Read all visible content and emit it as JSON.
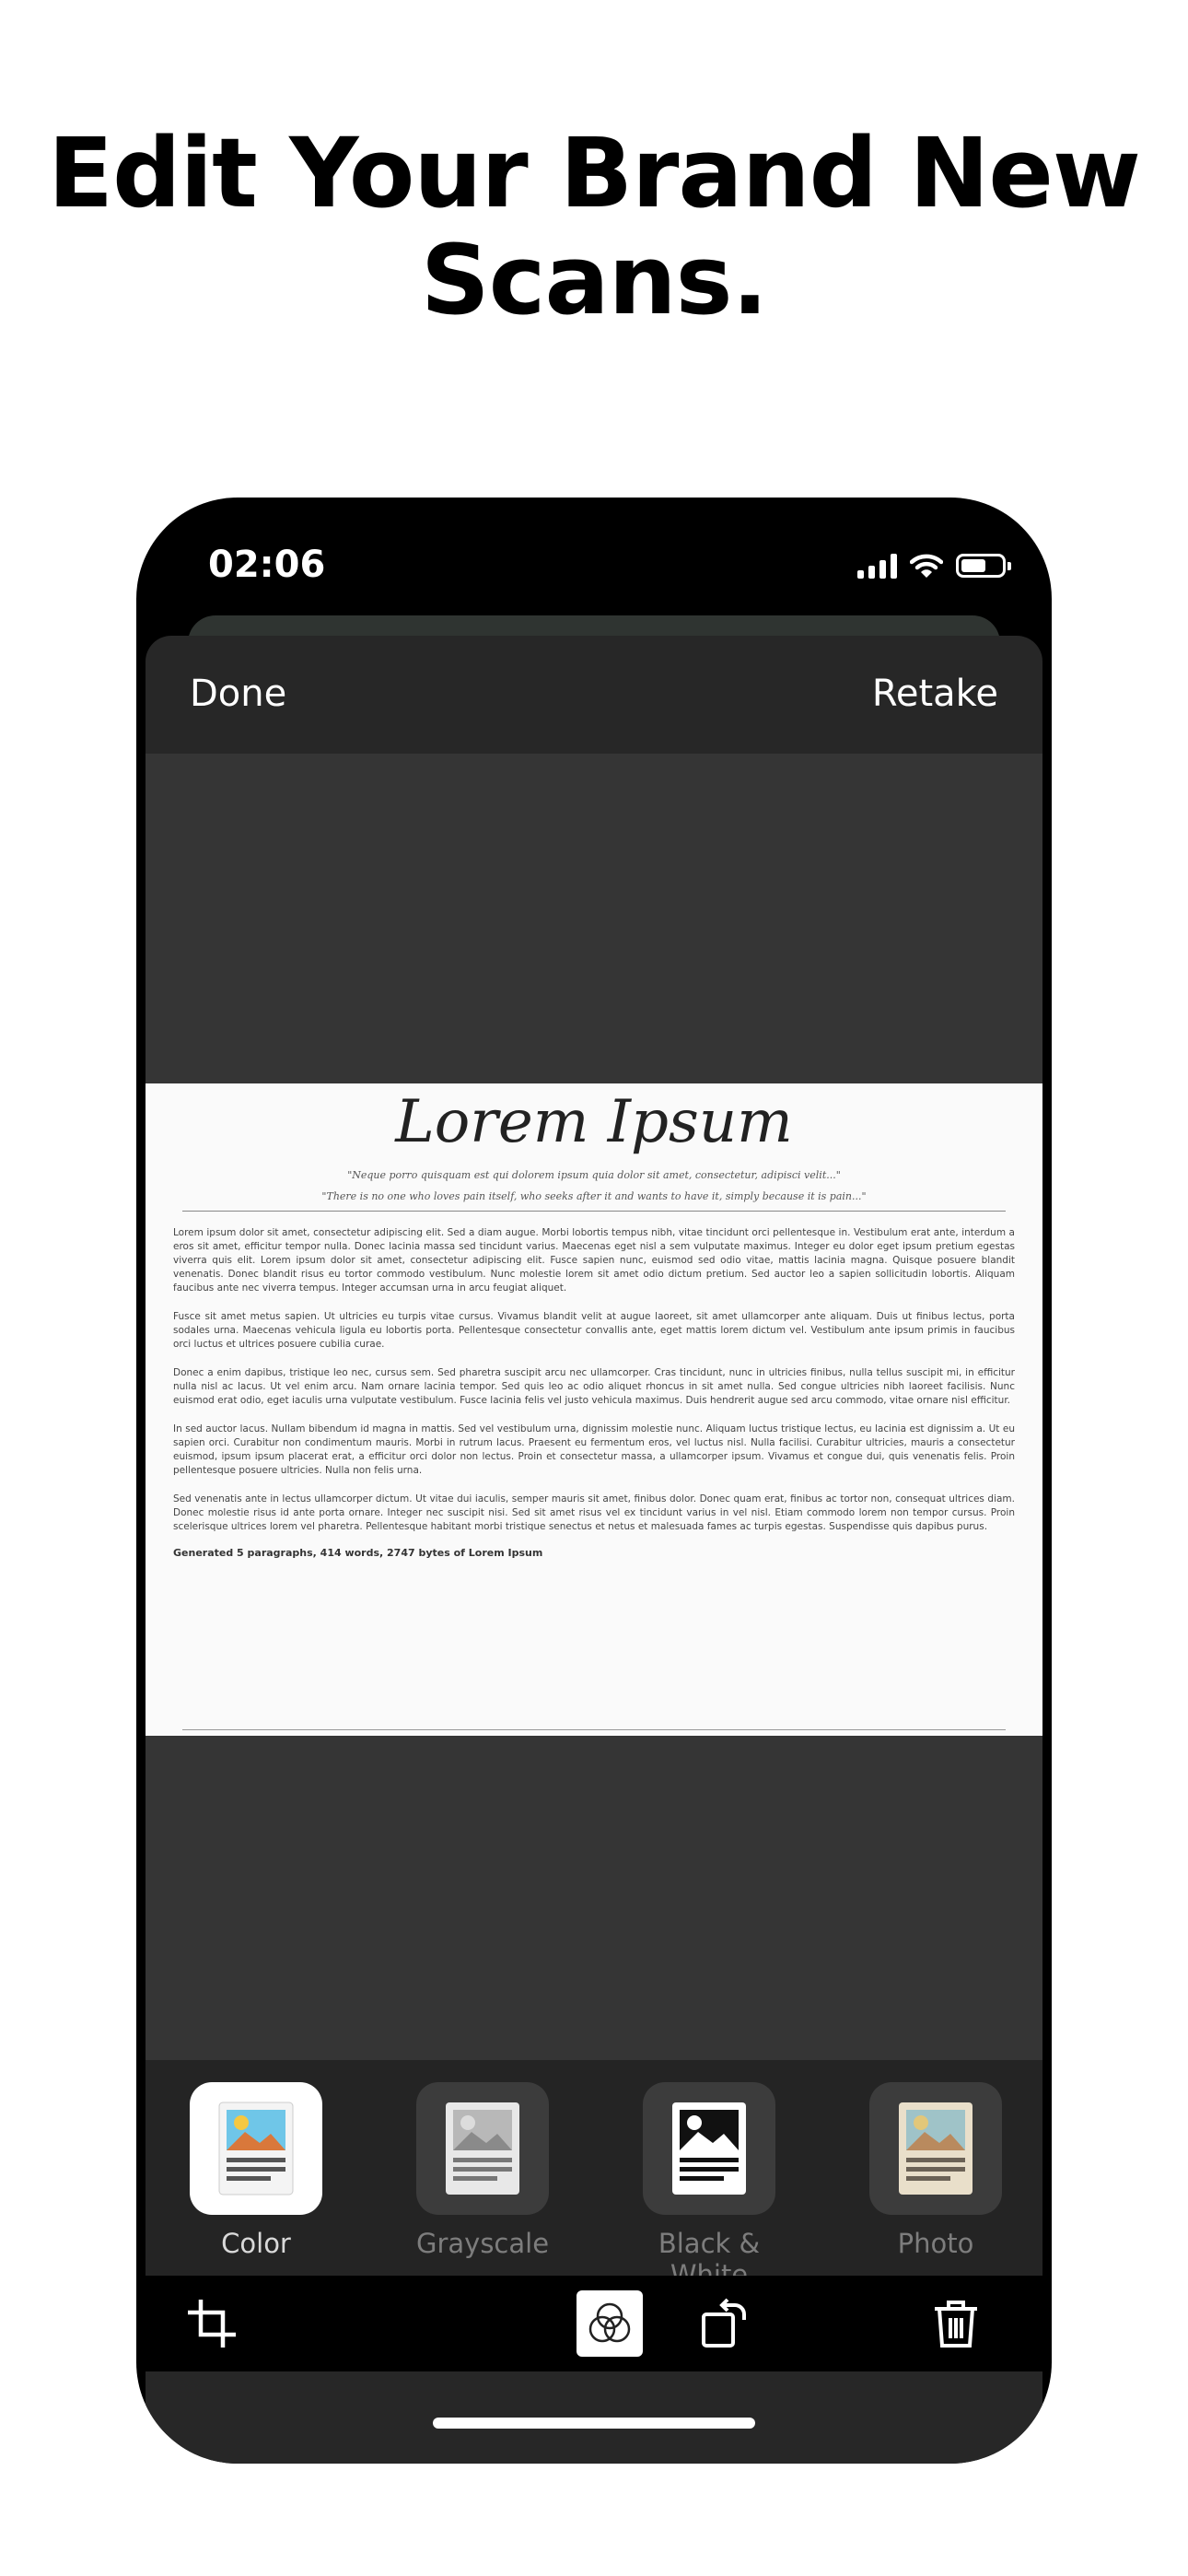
{
  "headline": {
    "line1": "Edit Your Brand New",
    "line2": "Scans."
  },
  "status_bar": {
    "time": "02:06",
    "icons": [
      "signal-icon",
      "wifi-icon",
      "battery-icon"
    ]
  },
  "nav": {
    "done": "Done",
    "retake": "Retake"
  },
  "document": {
    "title": "Lorem Ipsum",
    "quote1": "\"Neque porro quisquam est qui dolorem ipsum quia dolor sit amet, consectetur, adipisci velit...\"",
    "quote2": "\"There is no one who loves pain itself, who seeks after it and wants to have it, simply because it is pain...\"",
    "paragraphs": [
      "Lorem ipsum dolor sit amet, consectetur adipiscing elit. Sed a diam augue. Morbi lobortis tempus nibh, vitae tincidunt orci pellentesque in. Vestibulum erat ante, interdum a eros sit amet, efficitur tempor nulla. Donec lacinia massa sed tincidunt varius. Maecenas eget nisl a sem vulputate maximus. Integer eu dolor eget ipsum pretium egestas viverra quis elit. Lorem ipsum dolor sit amet, consectetur adipiscing elit. Fusce sapien nunc, euismod sed odio vitae, mattis lacinia magna. Quisque posuere blandit venenatis. Donec blandit risus eu tortor commodo vestibulum. Nunc molestie lorem sit amet odio dictum pretium. Sed auctor leo a sapien sollicitudin lobortis. Aliquam faucibus ante nec viverra tempus. Integer accumsan urna in arcu feugiat aliquet.",
      "Fusce sit amet metus sapien. Ut ultricies eu turpis vitae cursus. Vivamus blandit velit at augue laoreet, sit amet ullamcorper ante aliquam. Duis ut finibus lectus, porta sodales urna. Maecenas vehicula ligula eu lobortis porta. Pellentesque consectetur convallis ante, eget mattis lorem dictum vel. Vestibulum ante ipsum primis in faucibus orci luctus et ultrices posuere cubilia curae.",
      "Donec a enim dapibus, tristique leo nec, cursus sem. Sed pharetra suscipit arcu nec ullamcorper. Cras tincidunt, nunc in ultricies finibus, nulla tellus suscipit mi, in efficitur nulla nisl ac lacus. Ut vel enim arcu. Nam ornare lacinia tempor. Sed quis leo ac odio aliquet rhoncus in sit amet nulla. Sed congue ultricies nibh laoreet facilisis. Nunc euismod erat odio, eget iaculis urna vulputate vestibulum. Fusce lacinia felis vel justo vehicula maximus. Duis hendrerit augue sed arcu commodo, vitae ornare nisl efficitur.",
      "In sed auctor lacus. Nullam bibendum id magna in mattis. Sed vel vestibulum urna, dignissim molestie nunc. Aliquam luctus tristique lectus, eu lacinia est dignissim a. Ut eu sapien orci. Curabitur non condimentum mauris. Morbi in rutrum lacus. Praesent eu fermentum eros, vel luctus nisl. Nulla facilisi. Curabitur ultricies, mauris a consectetur euismod, ipsum ipsum placerat erat, a efficitur orci dolor non lectus. Proin et consectetur massa, a ullamcorper ipsum. Vivamus et congue dui, quis venenatis felis. Proin pellentesque posuere ultricies. Nulla non felis urna.",
      "Sed venenatis ante in lectus ullamcorper dictum. Ut vitae dui iaculis, semper mauris sit amet, finibus dolor. Donec quam erat, finibus ac tortor non, consequat ultrices diam. Donec molestie risus id ante porta ornare. Integer nec suscipit nisi. Sed sit amet risus vel ex tincidunt varius in vel nisl. Etiam commodo lorem non tempor cursus. Proin scelerisque ultrices lorem vel pharetra. Pellentesque habitant morbi tristique senectus et netus et malesuada fames ac turpis egestas. Suspendisse quis dapibus purus."
    ],
    "footer": "Generated 5 paragraphs, 414 words, 2747 bytes of Lorem Ipsum"
  },
  "filters": [
    {
      "label": "Color",
      "icon": "color-filter-icon",
      "active": true
    },
    {
      "label": "Grayscale",
      "icon": "grayscale-filter-icon",
      "active": false
    },
    {
      "label": "Black & White",
      "icon": "black-white-filter-icon",
      "active": false
    },
    {
      "label": "Photo",
      "icon": "photo-filter-icon",
      "active": false
    }
  ],
  "toolbar": [
    "crop-icon",
    "filter-icon",
    "rotate-icon",
    "trash-icon"
  ],
  "colors": {
    "accent": "#ffffff",
    "sheet": "#272727",
    "canvas": "#353535"
  }
}
